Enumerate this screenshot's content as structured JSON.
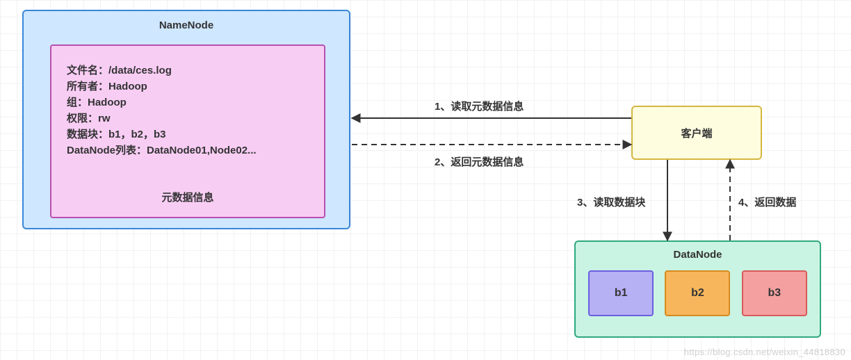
{
  "namenode": {
    "title": "NameNode",
    "metadata": {
      "filename_label": "文件名：/data/ces.log",
      "owner_label": "所有者：Hadoop",
      "group_label": "组：Hadoop",
      "perm_label": "权限：rw",
      "blocks_label": "数据块：b1，b2，b3",
      "dnlist_label": "DataNode列表：DataNode01,Node02...",
      "footer": "元数据信息"
    }
  },
  "client": {
    "label": "客户端"
  },
  "datanode": {
    "title": "DataNode",
    "blocks": {
      "b1": "b1",
      "b2": "b2",
      "b3": "b3"
    }
  },
  "arrows": {
    "step1": "1、读取元数据信息",
    "step2": "2、返回元数据信息",
    "step3": "3、读取数据块",
    "step4": "4、返回数据"
  },
  "watermark": "https://blog.csdn.net/weixin_44818830"
}
